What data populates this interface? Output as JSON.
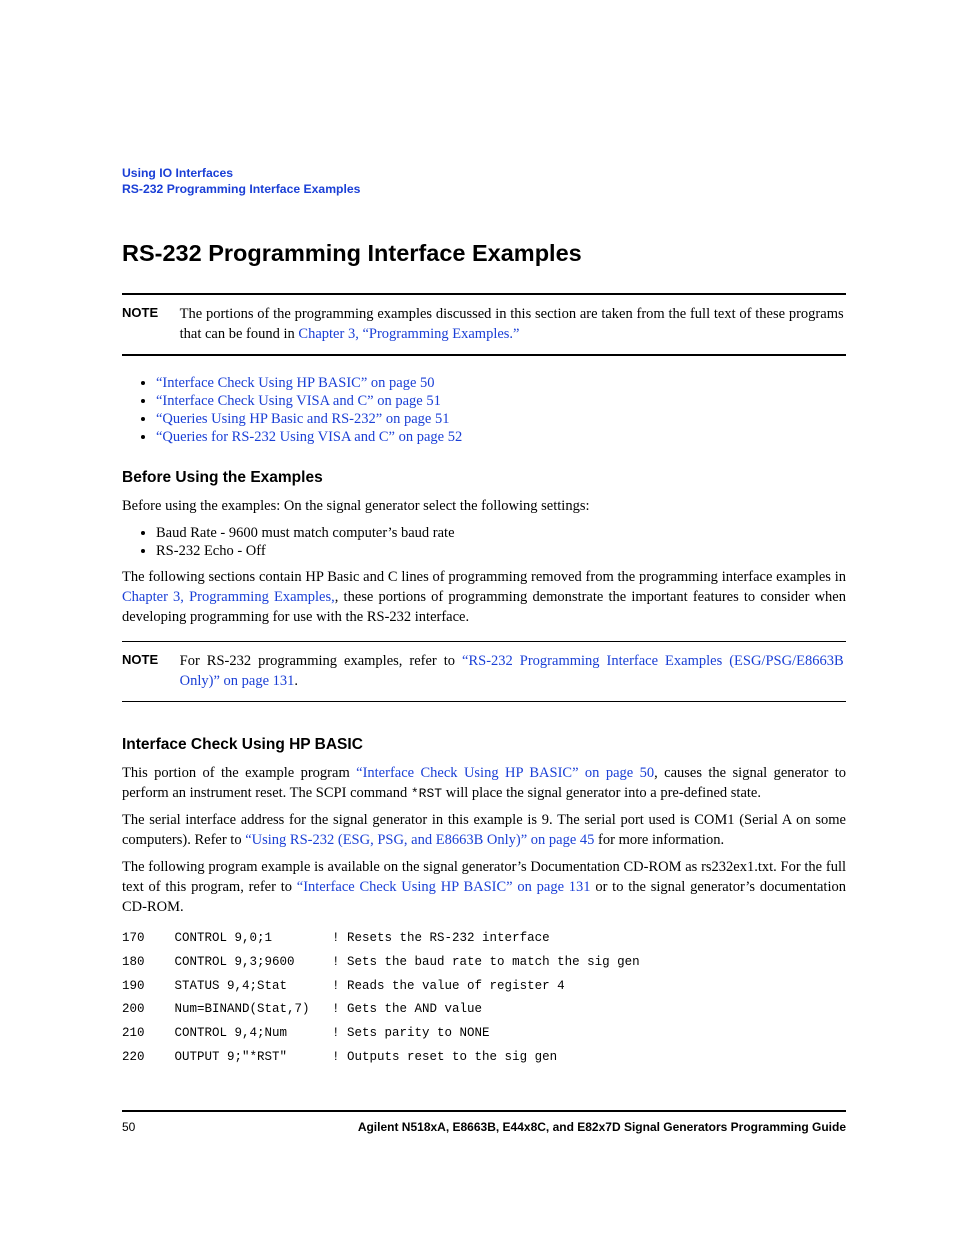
{
  "header": {
    "line1": "Using IO Interfaces",
    "line2": "RS-232 Programming Interface Examples"
  },
  "title": "RS-232 Programming Interface Examples",
  "note1": {
    "label": "NOTE",
    "pre": "The portions of the programming examples discussed in this section are taken from the full text of these programs that can be found in ",
    "link": "Chapter 3, “Programming Examples.”"
  },
  "toc": [
    "“Interface Check Using HP BASIC” on page 50",
    "“Interface Check Using VISA and C” on page 51",
    "“Queries Using HP Basic and RS-232” on page 51",
    "“Queries for RS-232 Using VISA and C” on page 52"
  ],
  "before": {
    "heading": "Before Using the Examples",
    "intro": "Before using the examples: On the signal generator select the following settings:",
    "bullets": [
      "Baud Rate - 9600 must match computer’s baud rate",
      "RS-232 Echo - Off"
    ],
    "para_pre": "The following sections contain HP Basic and C lines of programming removed from the programming interface examples in ",
    "para_link": "Chapter 3, Programming Examples,",
    "para_post": ", these portions of programming demonstrate the important features to consider when developing programming for use with the RS-232 interface."
  },
  "note2": {
    "label": "NOTE",
    "pre": "For RS-232 programming examples, refer to ",
    "link": "“RS-232 Programming Interface Examples (ESG/PSG/E8663B Only)” on page 131",
    "post": "."
  },
  "iface": {
    "heading": "Interface Check Using HP BASIC",
    "p1_pre": "This portion of the example program ",
    "p1_link": "“Interface Check Using HP BASIC” on page 50",
    "p1_mid": ", causes the signal generator to perform an instrument reset. The SCPI command ",
    "p1_code": "*RST",
    "p1_post": " will place the signal generator into a pre-defined state.",
    "p2_pre": "The serial interface address for the signal generator in this example is 9. The serial port used is COM1 (Serial A on some computers). Refer to ",
    "p2_link": "“Using RS-232 (ESG, PSG, and E8663B Only)” on page 45",
    "p2_post": " for more information.",
    "p3_pre": "The following program example is available on the signal generator’s Documentation CD-ROM as rs232ex1.txt. For the full text of this program, refer to ",
    "p3_link": "“Interface Check Using HP BASIC” on page 131",
    "p3_post": " or to the signal generator’s documentation CD-ROM."
  },
  "code": "170    CONTROL 9,0;1        ! Resets the RS-232 interface\n180    CONTROL 9,3;9600     ! Sets the baud rate to match the sig gen\n190    STATUS 9,4;Stat      ! Reads the value of register 4\n200    Num=BINAND(Stat,7)   ! Gets the AND value\n210    CONTROL 9,4;Num      ! Sets parity to NONE\n220    OUTPUT 9;\"*RST\"      ! Outputs reset to the sig gen",
  "footer": {
    "page": "50",
    "label": "Agilent N518xA, E8663B, E44x8C, and E82x7D Signal Generators Programming Guide"
  }
}
